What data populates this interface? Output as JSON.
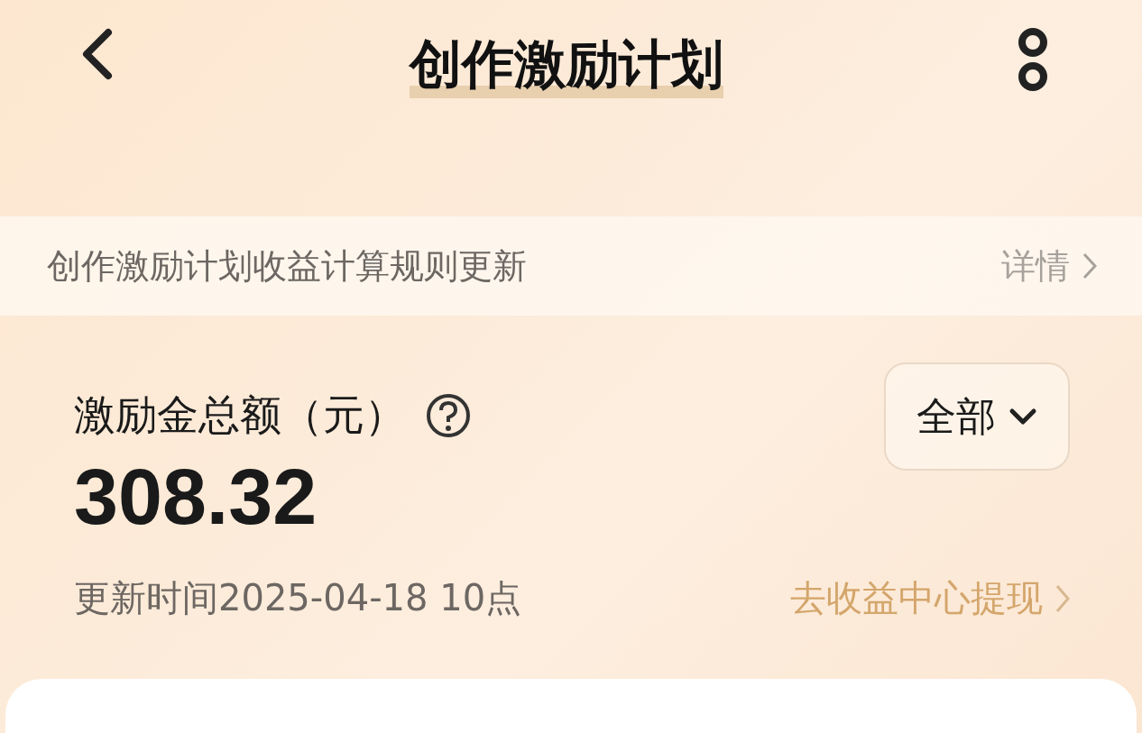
{
  "header": {
    "title": "创作激励计划"
  },
  "notice": {
    "text": "创作激励计划收益计算规则更新",
    "link": "详情"
  },
  "summary": {
    "label": "激励金总额（元）",
    "amount": "308.32",
    "filter": "全部",
    "updated": "更新时间2025-04-18 10点",
    "withdraw_link": "去收益中心提现"
  }
}
